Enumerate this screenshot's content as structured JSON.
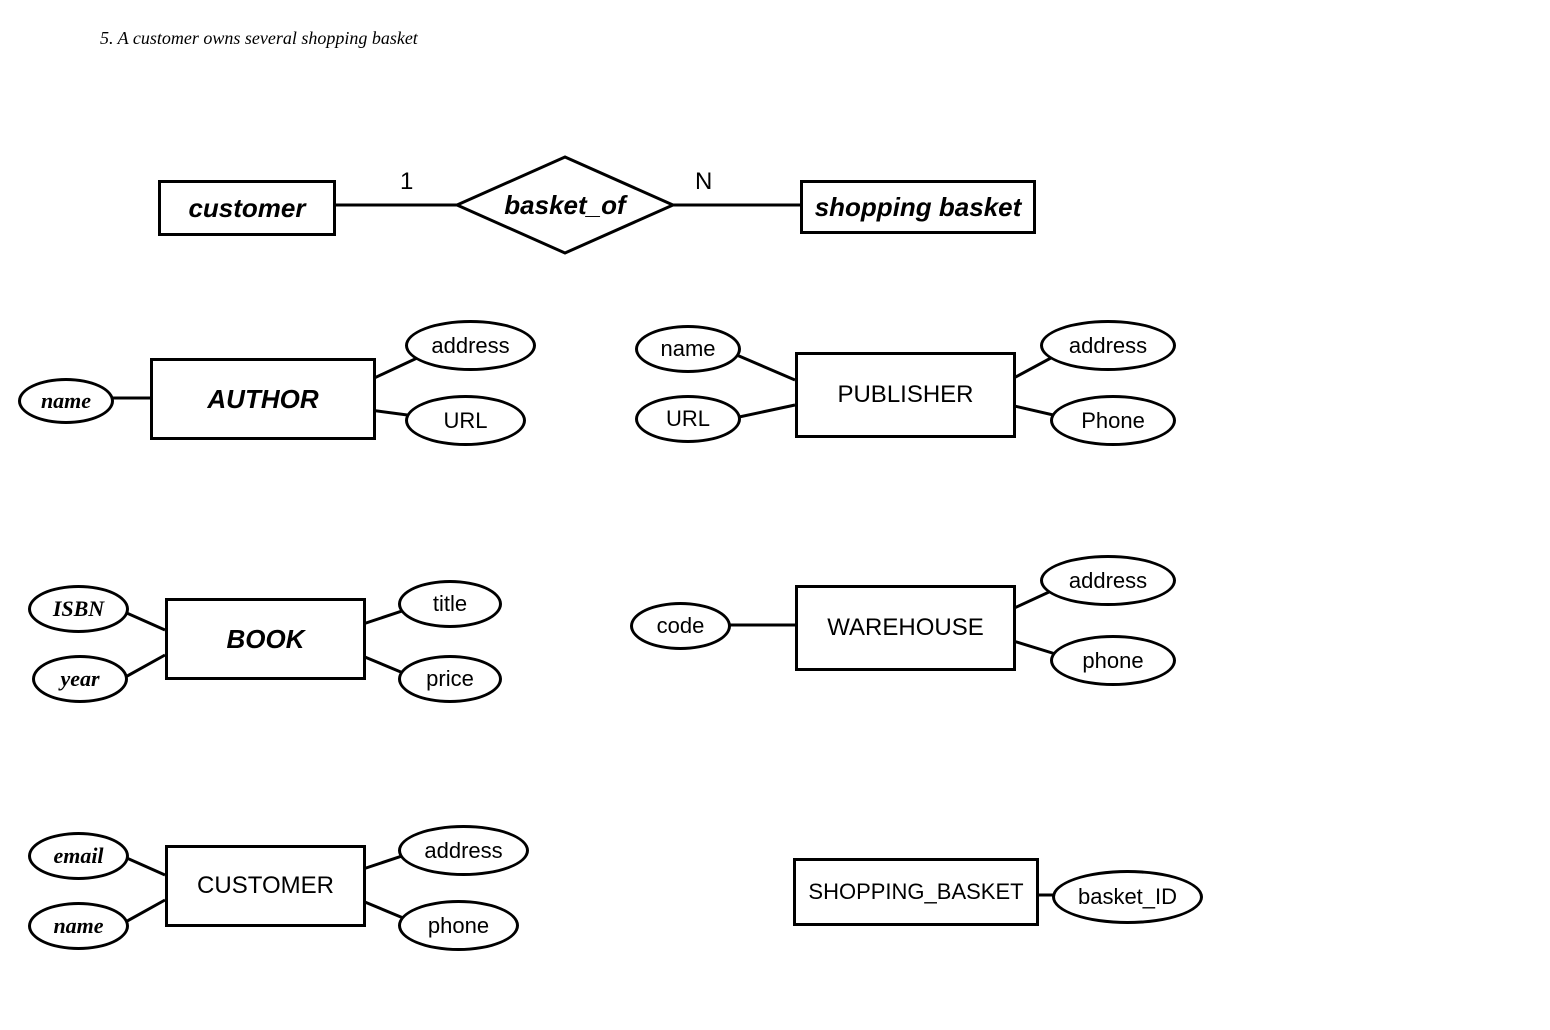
{
  "caption": "5. A customer owns several shopping basket",
  "relationship": {
    "left_entity": "customer",
    "diamond": "basket_of",
    "right_entity": "shopping basket",
    "card_left": "1",
    "card_right": "N"
  },
  "entities": {
    "author": {
      "name": "AUTHOR",
      "attrs": {
        "left1": "name",
        "right1": "address",
        "right2": "URL"
      }
    },
    "publisher": {
      "name": "PUBLISHER",
      "attrs": {
        "left1": "name",
        "left2": "URL",
        "right1": "address",
        "right2": "Phone"
      }
    },
    "book": {
      "name": "BOOK",
      "attrs": {
        "left1": "ISBN",
        "left2": "year",
        "right1": "title",
        "right2": "price"
      }
    },
    "warehouse": {
      "name": "WAREHOUSE",
      "attrs": {
        "left1": "code",
        "right1": "address",
        "right2": "phone"
      }
    },
    "customer": {
      "name": "CUSTOMER",
      "attrs": {
        "left1": "email",
        "left2": "name",
        "right1": "address",
        "right2": "phone"
      }
    },
    "shopping_basket": {
      "name": "SHOPPING_BASKET",
      "attrs": {
        "right1": "basket_ID"
      }
    }
  }
}
